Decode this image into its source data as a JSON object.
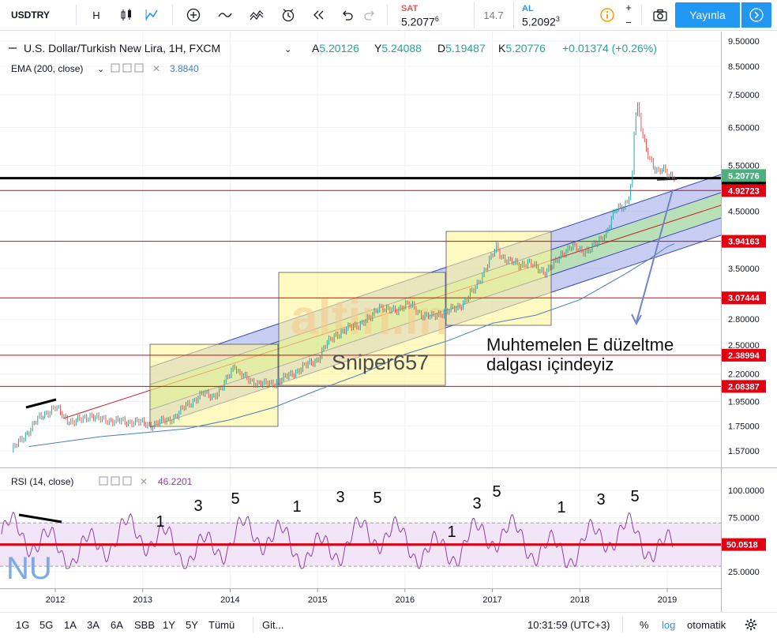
{
  "toolbar": {
    "symbol": "USDTRY",
    "interval": "H",
    "sell_label": "SAT",
    "sell_price_main": "5.2077",
    "sell_price_sup": "6",
    "spread": "14.7",
    "buy_label": "AL",
    "buy_price_main": "5.2092",
    "buy_price_sup": "3",
    "plus": "+",
    "minus": "−",
    "publish_label": "Yayınla"
  },
  "header": {
    "instrument": "U.S. Dollar/Turkish New Lira, 1H, FXCM",
    "open_label": "A",
    "open_value": "5.20126",
    "high_label": "Y",
    "high_value": "5.24088",
    "low_label": "D",
    "low_value": "5.19487",
    "close_label": "K",
    "close_value": "5.20776",
    "change": "+0.01374 (+0.26%)",
    "ema_label": "EMA (200, close)",
    "ema_value": "3.8840",
    "rsi_label": "RSI (14, close)",
    "rsi_value": "46.2201"
  },
  "chart_data": [
    {
      "type": "line",
      "title": "U.S. Dollar/Turkish New Lira, 1H, FXCM",
      "scale": "log",
      "ylim": [
        1.5,
        10.0
      ],
      "yticks": [
        "9.50000",
        "8.50000",
        "7.50000",
        "6.50000",
        "5.50000",
        "4.50000",
        "3.50000",
        "2.80000",
        "2.50000",
        "2.20000",
        "1.95000",
        "1.75000",
        "1.57000"
      ],
      "xticks": [
        "2012",
        "2013",
        "2014",
        "2015",
        "2016",
        "2017",
        "2018",
        "2019"
      ],
      "series": [
        {
          "name": "USDTRY",
          "points": [
            [
              2011.5,
              1.57
            ],
            [
              2011.6,
              1.64
            ],
            [
              2011.7,
              1.72
            ],
            [
              2011.8,
              1.8
            ],
            [
              2011.9,
              1.86
            ],
            [
              2012.0,
              1.9
            ],
            [
              2012.1,
              1.82
            ],
            [
              2012.2,
              1.78
            ],
            [
              2012.3,
              1.8
            ],
            [
              2012.4,
              1.84
            ],
            [
              2012.5,
              1.8
            ],
            [
              2012.6,
              1.8
            ],
            [
              2012.7,
              1.79
            ],
            [
              2012.8,
              1.78
            ],
            [
              2012.9,
              1.79
            ],
            [
              2013.0,
              1.77
            ],
            [
              2013.1,
              1.76
            ],
            [
              2013.2,
              1.78
            ],
            [
              2013.3,
              1.8
            ],
            [
              2013.4,
              1.84
            ],
            [
              2013.5,
              1.92
            ],
            [
              2013.6,
              1.97
            ],
            [
              2013.7,
              2.02
            ],
            [
              2013.8,
              2.0
            ],
            [
              2013.9,
              2.05
            ],
            [
              2014.0,
              2.22
            ],
            [
              2014.05,
              2.3
            ],
            [
              2014.1,
              2.2
            ],
            [
              2014.2,
              2.15
            ],
            [
              2014.3,
              2.12
            ],
            [
              2014.4,
              2.1
            ],
            [
              2014.5,
              2.12
            ],
            [
              2014.6,
              2.15
            ],
            [
              2014.7,
              2.2
            ],
            [
              2014.8,
              2.25
            ],
            [
              2014.9,
              2.3
            ],
            [
              2015.0,
              2.35
            ],
            [
              2015.1,
              2.5
            ],
            [
              2015.2,
              2.62
            ],
            [
              2015.3,
              2.65
            ],
            [
              2015.4,
              2.72
            ],
            [
              2015.5,
              2.75
            ],
            [
              2015.6,
              2.8
            ],
            [
              2015.7,
              2.98
            ],
            [
              2015.8,
              2.9
            ],
            [
              2015.9,
              2.92
            ],
            [
              2016.0,
              2.98
            ],
            [
              2016.1,
              2.95
            ],
            [
              2016.2,
              2.85
            ],
            [
              2016.3,
              2.82
            ],
            [
              2016.4,
              2.88
            ],
            [
              2016.5,
              2.9
            ],
            [
              2016.6,
              2.95
            ],
            [
              2016.7,
              3.05
            ],
            [
              2016.8,
              3.2
            ],
            [
              2016.9,
              3.45
            ],
            [
              2017.0,
              3.7
            ],
            [
              2017.05,
              3.85
            ],
            [
              2017.1,
              3.7
            ],
            [
              2017.2,
              3.6
            ],
            [
              2017.3,
              3.55
            ],
            [
              2017.4,
              3.6
            ],
            [
              2017.5,
              3.5
            ],
            [
              2017.6,
              3.45
            ],
            [
              2017.65,
              3.5
            ],
            [
              2017.7,
              3.55
            ],
            [
              2017.8,
              3.75
            ],
            [
              2017.9,
              3.85
            ],
            [
              2018.0,
              3.78
            ],
            [
              2018.1,
              3.8
            ],
            [
              2018.2,
              3.9
            ],
            [
              2018.3,
              4.1
            ],
            [
              2018.4,
              4.5
            ],
            [
              2018.5,
              4.6
            ],
            [
              2018.55,
              4.75
            ],
            [
              2018.6,
              5.2
            ],
            [
              2018.63,
              6.8
            ],
            [
              2018.66,
              7.1
            ],
            [
              2018.7,
              6.5
            ],
            [
              2018.75,
              6.0
            ],
            [
              2018.8,
              5.7
            ],
            [
              2018.85,
              5.4
            ],
            [
              2018.9,
              5.3
            ],
            [
              2018.95,
              5.45
            ],
            [
              2019.0,
              5.35
            ],
            [
              2019.05,
              5.25
            ],
            [
              2019.08,
              5.21
            ]
          ]
        },
        {
          "name": "EMA (200, close)",
          "points": [
            [
              2011.7,
              1.6
            ],
            [
              2012.5,
              1.67
            ],
            [
              2013.0,
              1.7
            ],
            [
              2013.5,
              1.73
            ],
            [
              2014.0,
              1.8
            ],
            [
              2014.5,
              1.9
            ],
            [
              2015.0,
              2.05
            ],
            [
              2015.5,
              2.2
            ],
            [
              2016.0,
              2.4
            ],
            [
              2016.5,
              2.55
            ],
            [
              2017.0,
              2.75
            ],
            [
              2017.5,
              2.85
            ],
            [
              2018.0,
              3.05
            ],
            [
              2018.5,
              3.4
            ],
            [
              2018.8,
              3.65
            ],
            [
              2019.0,
              3.85
            ],
            [
              2019.08,
              3.9
            ]
          ]
        }
      ],
      "horizontal_levels": [
        {
          "value": "5.20280",
          "color": "#000000"
        },
        {
          "value": "4.92723",
          "color": "#e0000f"
        },
        {
          "value": "3.94163",
          "color": "#e0000f"
        },
        {
          "value": "3.07444",
          "color": "#e0000f"
        },
        {
          "value": "2.38994",
          "color": "#e0000f"
        },
        {
          "value": "2.08387",
          "color": "#e0000f"
        }
      ],
      "current_price": "5.20776",
      "annotations": [
        "Muhtemelen E düzeltme",
        "dalgası içindeyiz",
        "Sniper657"
      ],
      "watermark": "altin.in"
    },
    {
      "type": "line",
      "title": "RSI (14, close)",
      "ylim": [
        15,
        110
      ],
      "yticks": [
        "100.0000",
        "75.0000",
        "50.0000",
        "25.0000"
      ],
      "band": [
        30,
        70
      ],
      "level": "50.0518",
      "wave_labels": [
        "1",
        "3",
        "5",
        "1",
        "3",
        "5",
        "1",
        "3",
        "5",
        "1",
        "3",
        "5"
      ],
      "corner_label": "NU"
    }
  ],
  "bottom": {
    "ranges": [
      "1G",
      "5G",
      "1A",
      "3A",
      "6A",
      "SBB",
      "1Y",
      "5Y",
      "Tümü"
    ],
    "goto": "Git...",
    "clock": "10:31:59 (UTC+3)",
    "percent": "%",
    "log": "log",
    "auto": "otomatik"
  },
  "colors": {
    "up": "#26a69a",
    "down": "#ef5350",
    "ema": "#4a7fb5",
    "rsi": "#8e3fa8",
    "rsi_band": "#f3e5f8",
    "level_red": "#e0000f",
    "accent": "#2196f3",
    "channel_blue": "#9aa6ea",
    "channel_green": "#b6e6a6",
    "box_yellow": "#fff59a"
  }
}
